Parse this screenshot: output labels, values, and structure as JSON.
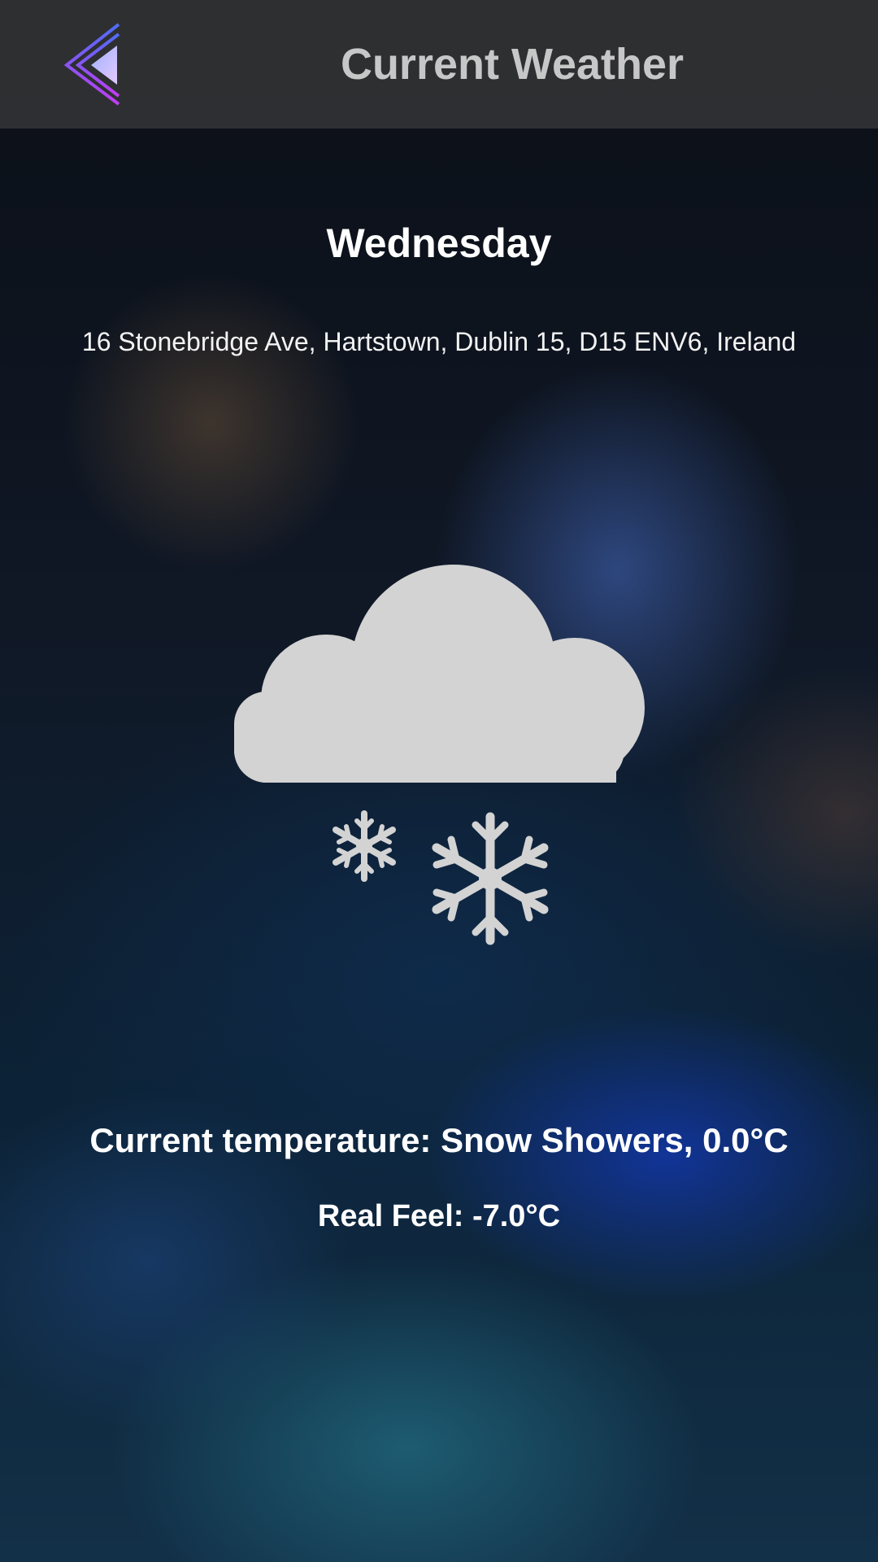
{
  "header": {
    "title": "Current Weather",
    "back_icon": "back-chevron-icon"
  },
  "weather": {
    "day": "Wednesday",
    "address": "16 Stonebridge Ave, Hartstown, Dublin 15, D15 ENV6, Ireland",
    "condition_icon": "snow-showers-icon",
    "temperature_text": "Current temperature: Snow Showers, 0.0°C",
    "real_feel_text": "Real Feel: -7.0°C"
  },
  "colors": {
    "topbar": "#3c3c3c",
    "title": "#c7c7c7",
    "icon_fill": "#d3d3d3",
    "back_gradient_start": "#4f6df5",
    "back_gradient_end": "#c13df2"
  }
}
